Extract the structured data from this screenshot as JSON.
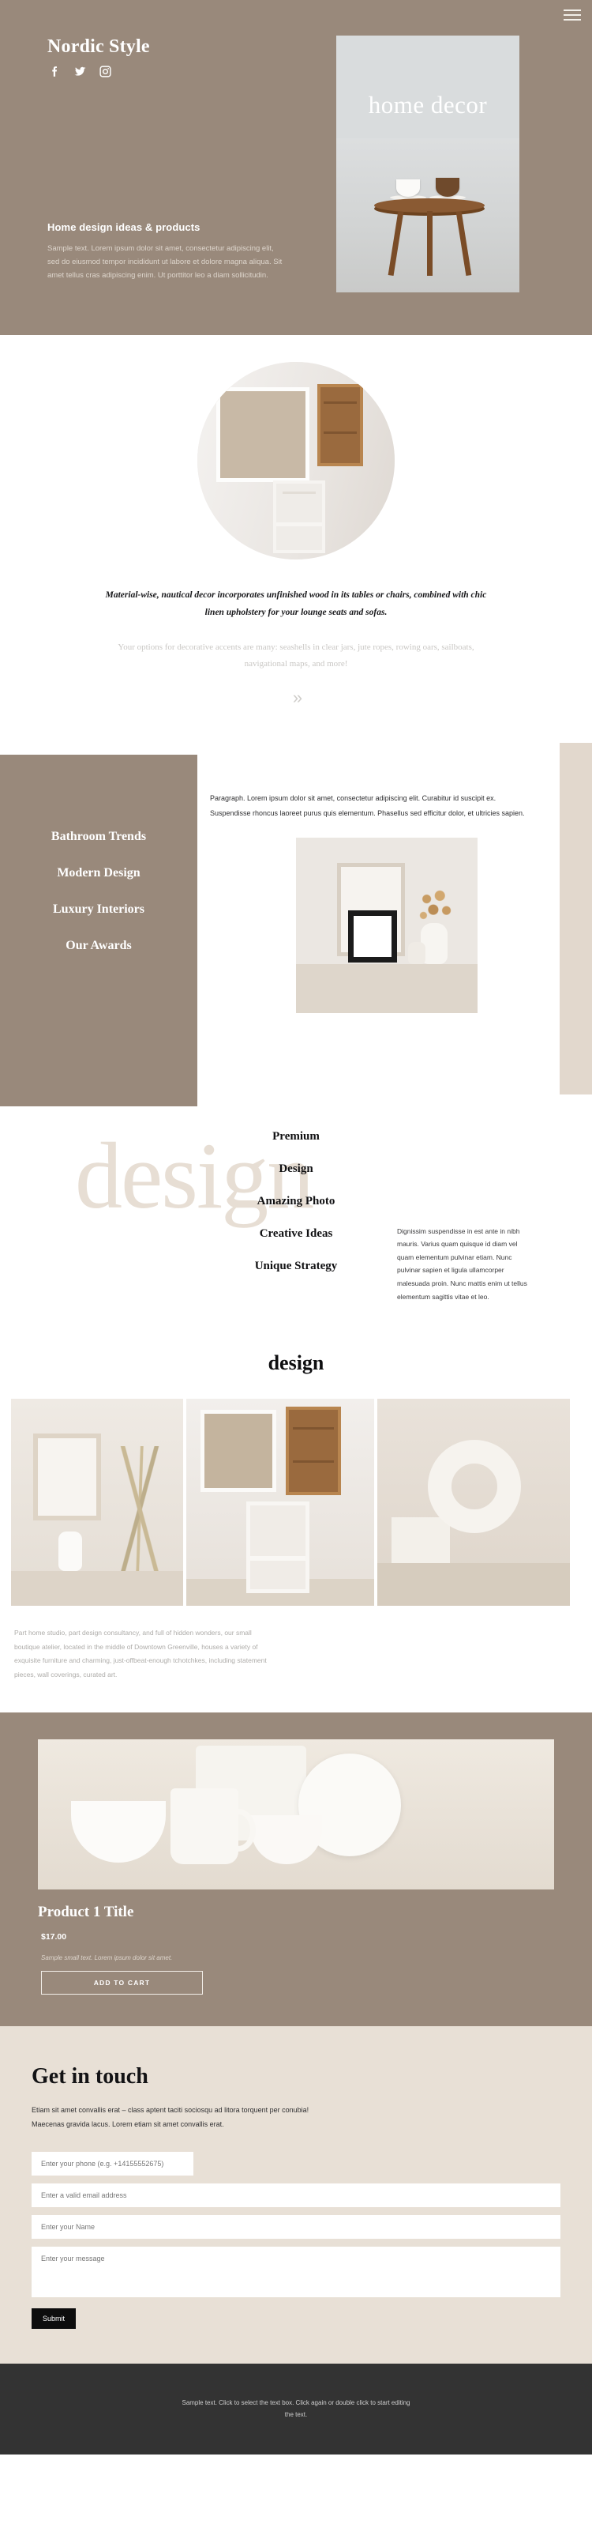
{
  "colors": {
    "brand_taupe": "#99897b",
    "sand": "#e2d8cd",
    "contact_bg": "#e8e0d6",
    "footer_bg": "#333333",
    "watermark": "#e7ded4",
    "dark": "#0d0d0d"
  },
  "hero": {
    "menu_icon": "hamburger-menu-icon",
    "brand": "Nordic Style",
    "socials": [
      {
        "name": "facebook-icon",
        "label": "Facebook"
      },
      {
        "name": "twitter-icon",
        "label": "Twitter"
      },
      {
        "name": "instagram-icon",
        "label": "Instagram"
      }
    ],
    "heading": "Home design ideas & products",
    "paragraph": "Sample text. Lorem ipsum dolor sit amet, consectetur adipiscing elit, sed do eiusmod tempor incididunt ut labore et dolore magna aliqua. Sit amet tellus cras adipiscing enim. Ut porttitor leo a diam sollicitudin.",
    "card_label": "home decor"
  },
  "intro": {
    "quote": "Material-wise, nautical decor incorporates unfinished wood in its tables or chairs, combined with chic linen upholstery for your lounge seats and sofas.",
    "subquote": "Your options for decorative accents are many: seashells in clear jars, jute ropes, rowing oars, sailboats, navigational maps, and more!",
    "chevrons": "»"
  },
  "menu_section": {
    "items": [
      {
        "label": "Bathroom Trends"
      },
      {
        "label": "Modern Design"
      },
      {
        "label": "Luxury Interiors"
      },
      {
        "label": "Our Awards"
      }
    ],
    "paragraph_line1": "Paragraph. Lorem ipsum dolor sit amet, consectetur adipiscing elit. Curabitur id suscipit ex.",
    "paragraph_line2": "Suspendisse rhoncus laoreet purus quis elementum. Phasellus sed efficitur dolor, et ultricies sapien."
  },
  "design_section": {
    "watermark": "design",
    "items": [
      {
        "label": "Premium"
      },
      {
        "label": "Design"
      },
      {
        "label": "Amazing Photo"
      },
      {
        "label": "Creative Ideas"
      },
      {
        "label": "Unique Strategy"
      }
    ],
    "paragraph": "Dignissim suspendisse in est ante in nibh mauris. Varius quam quisque id diam vel quam elementum pulvinar etiam. Nunc pulvinar sapien et ligula ullamcorper malesuada proin. Nunc mattis enim ut tellus elementum sagittis vitae et leo."
  },
  "gallery": {
    "title": "design",
    "images": [
      {
        "alt": "framed-art-with-plant"
      },
      {
        "alt": "window-with-chair"
      },
      {
        "alt": "donut-vase-sculpture"
      }
    ],
    "paragraph": "Part home studio, part design consultancy, and full of hidden wonders, our small boutique atelier, located in the middle of Downtown Greenville, houses a variety of exquisite furniture and charming, just-offbeat-enough tchotchkes, including statement pieces, wall coverings, curated art."
  },
  "product": {
    "image_alt": "ceramic-tableware-set",
    "title": "Product 1 Title",
    "price": "$17.00",
    "description": "Sample small text. Lorem ipsum dolor sit amet.",
    "add_to_cart": "ADD TO CART"
  },
  "contact": {
    "title": "Get in touch",
    "subtitle": "Etiam sit amet convallis erat – class aptent taciti sociosqu ad litora torquent per conubia! Maecenas gravida lacus. Lorem etiam sit amet convallis erat.",
    "fields": {
      "phone_placeholder": "Enter your phone (e.g. +14155552675)",
      "email_placeholder": "Enter a valid email address",
      "name_placeholder": "Enter your Name",
      "message_placeholder": "Enter your message"
    },
    "submit_label": "Submit"
  },
  "footer": {
    "text": "Sample text. Click to select the text box. Click again or double click to start editing the text."
  }
}
